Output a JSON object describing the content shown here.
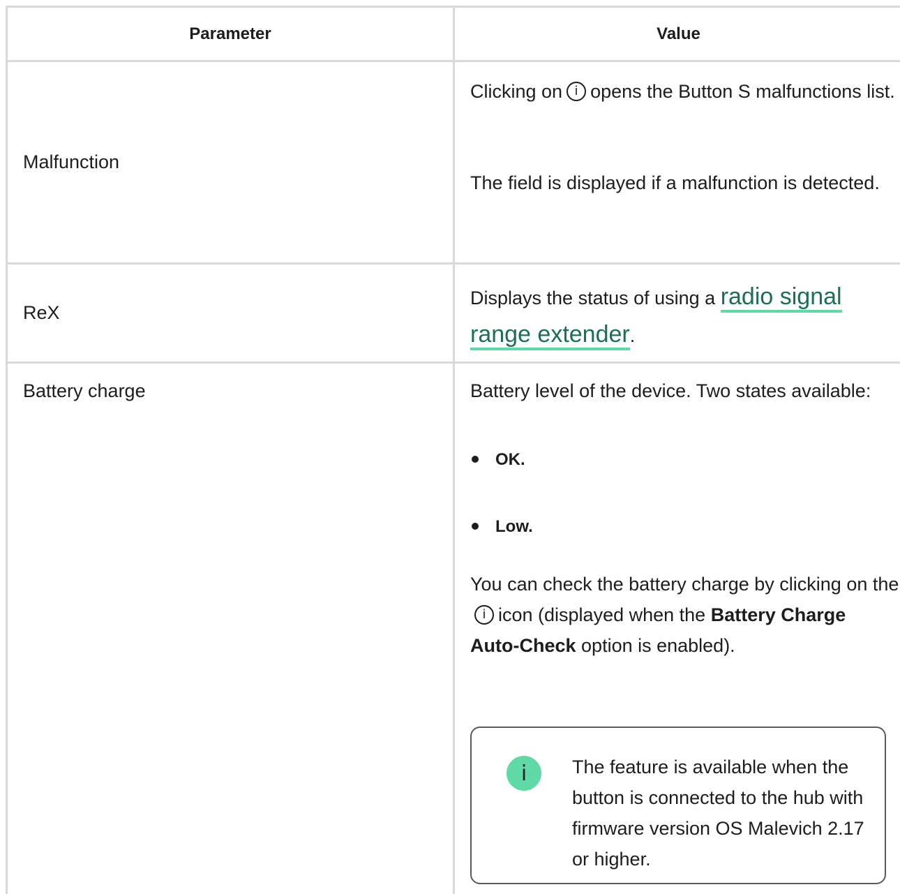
{
  "table": {
    "header": {
      "parameter": "Parameter",
      "value": "Value"
    },
    "rows": [
      {
        "parameter": "Malfunction",
        "line1_before": "Clicking on",
        "line1_after": "opens the Button S malfunctions list.",
        "line2": "The field is displayed if a malfunction is detected."
      },
      {
        "parameter": "ReX",
        "text_before": "Displays the status of using a",
        "link_text": "radio signal range extender",
        "text_after": "."
      },
      {
        "parameter": "Battery charge",
        "intro": "Battery level of the device. Two states available:",
        "states": [
          "OK.",
          "Low."
        ],
        "check_before": "You can check the battery charge by clicking on the",
        "check_middle": "icon (displayed when the",
        "check_bold": "Battery Charge Auto-Check",
        "check_after": "option is enabled).",
        "note": "The feature is available when the button is connected to the hub with firmware version OS Malevich 2.17 or higher."
      }
    ]
  },
  "icons": {
    "info": "info-icon",
    "note_badge": "info-icon"
  },
  "colors": {
    "border": "#d9d9d9",
    "accent": "#5fd9a5",
    "link": "#1d6f52",
    "text": "#1d1d1f"
  }
}
